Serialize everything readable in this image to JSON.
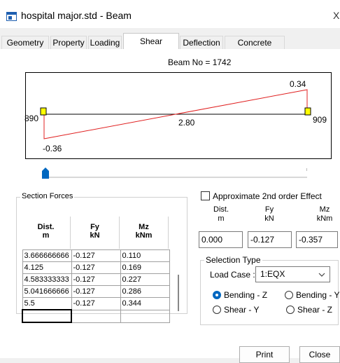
{
  "window": {
    "title": "hospital major.std - Beam",
    "close_glyph": "X"
  },
  "tabs": [
    "Geometry",
    "Property",
    "Loading",
    "Shear Bending",
    "Deflection",
    "Concrete Design"
  ],
  "active_tab": "Shear Bending",
  "diagram": {
    "beam_no_label": "Beam No = 1742",
    "start_node": "890",
    "end_node": "909",
    "max_value": "0.34",
    "min_value": "-0.36",
    "zero_crossing": "2.80",
    "line_color": "#e02020",
    "support_color": "#ffff00"
  },
  "section_forces": {
    "title": "Section Forces",
    "headers": [
      {
        "name": "Dist.",
        "unit": "m"
      },
      {
        "name": "Fy",
        "unit": "kN"
      },
      {
        "name": "Mz",
        "unit": "kNm"
      }
    ],
    "rows": [
      [
        "3.666666666",
        "-0.127",
        "0.110"
      ],
      [
        "4.125",
        "-0.127",
        "0.169"
      ],
      [
        "4.583333333",
        "-0.127",
        "0.227"
      ],
      [
        "5.041666666",
        "-0.127",
        "0.286"
      ],
      [
        "5.5",
        "-0.127",
        "0.344"
      ],
      [
        "",
        "",
        ""
      ]
    ]
  },
  "approx": {
    "checkbox_label": "Approximate 2nd order Effect",
    "checked": false,
    "dist_label": "Dist.",
    "dist_unit": "m",
    "fy_label": "Fy",
    "fy_unit": "kN",
    "mz_label": "Mz",
    "mz_unit": "kNm",
    "dist_value": "0.000",
    "fy_value": "-0.127",
    "mz_value": "-0.357"
  },
  "selection": {
    "title": "Selection Type",
    "load_case_label": "Load Case :",
    "load_case_value": "1:EQX",
    "options": [
      "Bending - Z",
      "Bending - Y",
      "Shear - Y",
      "Shear - Z"
    ],
    "selected": "Bending - Z"
  },
  "buttons": {
    "print": "Print",
    "close": "Close"
  },
  "colors": {
    "accent": "#0067c0"
  }
}
